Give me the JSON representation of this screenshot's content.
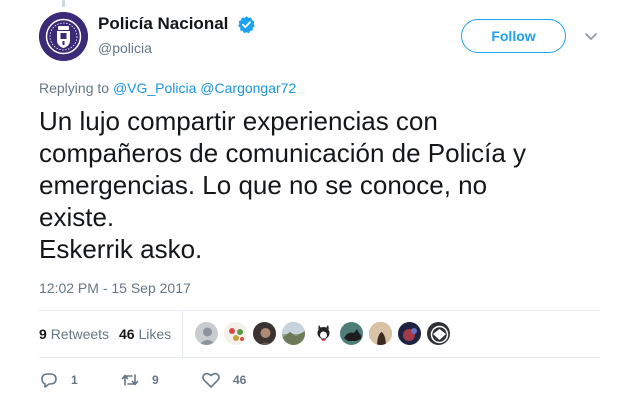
{
  "user": {
    "display_name": "Policía Nacional",
    "handle": "@policia",
    "verified_icon": "verified-badge-icon"
  },
  "follow_label": "Follow",
  "reply_context": {
    "prefix": "Replying to",
    "mentions": [
      "@VG_Policia",
      "@Cargongar72"
    ]
  },
  "tweet": {
    "lines": [
      "Un lujo compartir experiencias con",
      "compañeros de comunicación de Policía y",
      "emergencias. Lo que no se conoce, no",
      "existe.",
      "Eskerrik asko."
    ]
  },
  "timestamp": "12:02 PM - 15 Sep 2017",
  "stats": {
    "retweets_count": "9",
    "retweets_label": "Retweets",
    "likes_count": "46",
    "likes_label": "Likes"
  },
  "actions": {
    "reply_count": "1",
    "retweet_count": "9",
    "like_count": "46"
  },
  "colors": {
    "accent": "#1da1f2",
    "mention": "#1b95e0",
    "secondary_text": "#657786",
    "avatar_bg": "#3b2a78"
  }
}
